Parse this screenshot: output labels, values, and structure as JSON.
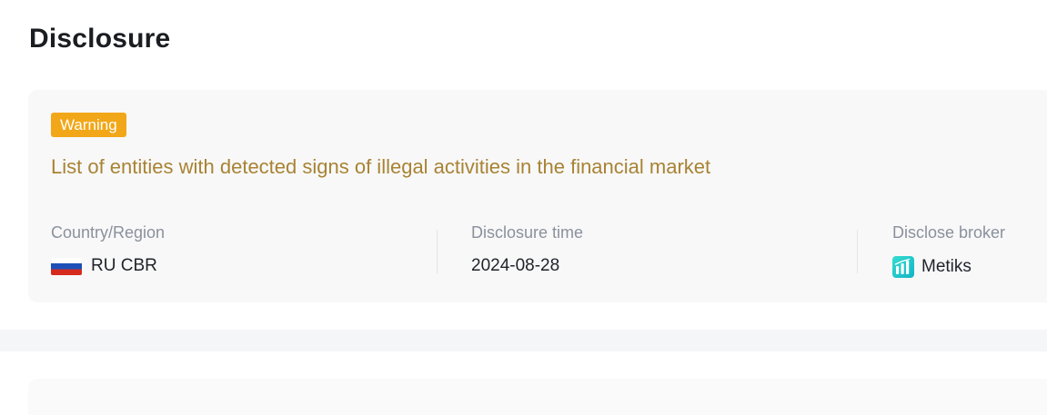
{
  "page": {
    "title": "Disclosure"
  },
  "disclosure": {
    "badge": "Warning",
    "headline": "List of entities with detected signs of illegal activities in the financial market",
    "country": {
      "label": "Country/Region",
      "value": "RU CBR",
      "flag_icon": "russia-flag-icon"
    },
    "time": {
      "label": "Disclosure time",
      "value": "2024-08-28"
    },
    "broker": {
      "label": "Disclose broker",
      "value": "Metiks",
      "logo_icon": "metiks-logo-icon"
    }
  },
  "colors": {
    "badge_bg": "#f2a718",
    "headline": "#a88333",
    "card_bg": "#f8f8f9",
    "label": "#8a919c",
    "broker_logo": "#1cc9c4"
  }
}
